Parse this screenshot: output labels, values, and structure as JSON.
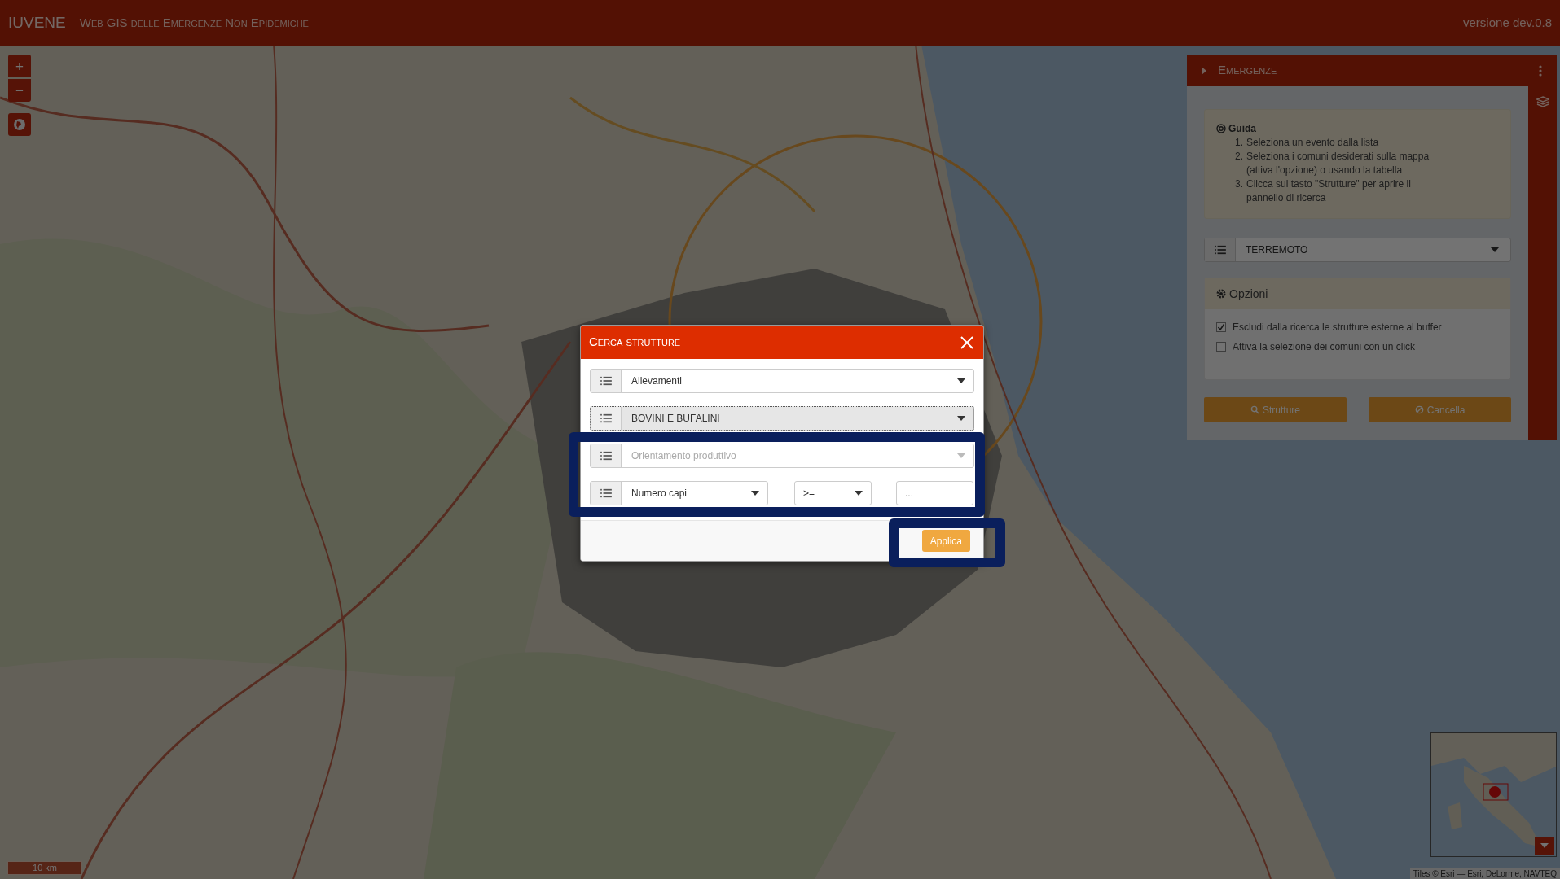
{
  "header": {
    "brand": "IUVENE",
    "subtitle": "Web GIS delle Emergenze Non Epidemiche",
    "version": "versione dev.0.8"
  },
  "map": {
    "kind": "picture",
    "zoom_in": "+",
    "zoom_out": "−",
    "scale": "10 km",
    "attribution": "Tiles © Esri — Esri, DeLorme, NAVTEQ"
  },
  "panel": {
    "title": "Emergenze",
    "guide_title": "Guida",
    "steps": [
      {
        "number": "1.",
        "text": "Seleziona un evento dalla lista"
      },
      {
        "number": "2.",
        "text": "Seleziona i comuni desiderati sulla mappa (attiva l'opzione) o usando la tabella"
      },
      {
        "number": "3.",
        "text": "Clicca sul tasto \"Strutture\" per aprire il pannello di ricerca"
      }
    ],
    "event": "TERREMOTO",
    "options_title": "Opzioni",
    "options": [
      {
        "label": "Escludi dalla ricerca le strutture esterne al buffer",
        "checked": true
      },
      {
        "label": "Attiva la selezione dei comuni con un click",
        "checked": false
      }
    ],
    "buttons": [
      {
        "label": "Strutture",
        "kind": "search"
      },
      {
        "label": "Cancella",
        "kind": "cancel"
      }
    ]
  },
  "modal": {
    "title": "Cerca strutture",
    "fields": [
      {
        "value": "Allevamenti",
        "focused": false
      },
      {
        "value": "BOVINI E BUFALINI",
        "focused": true
      },
      {
        "placeholder": "Orientamento produttivo",
        "focused": false
      }
    ],
    "filter": {
      "field": "Numero capi",
      "operator": ">=",
      "placeholder": "..."
    },
    "apply": "Applica"
  }
}
